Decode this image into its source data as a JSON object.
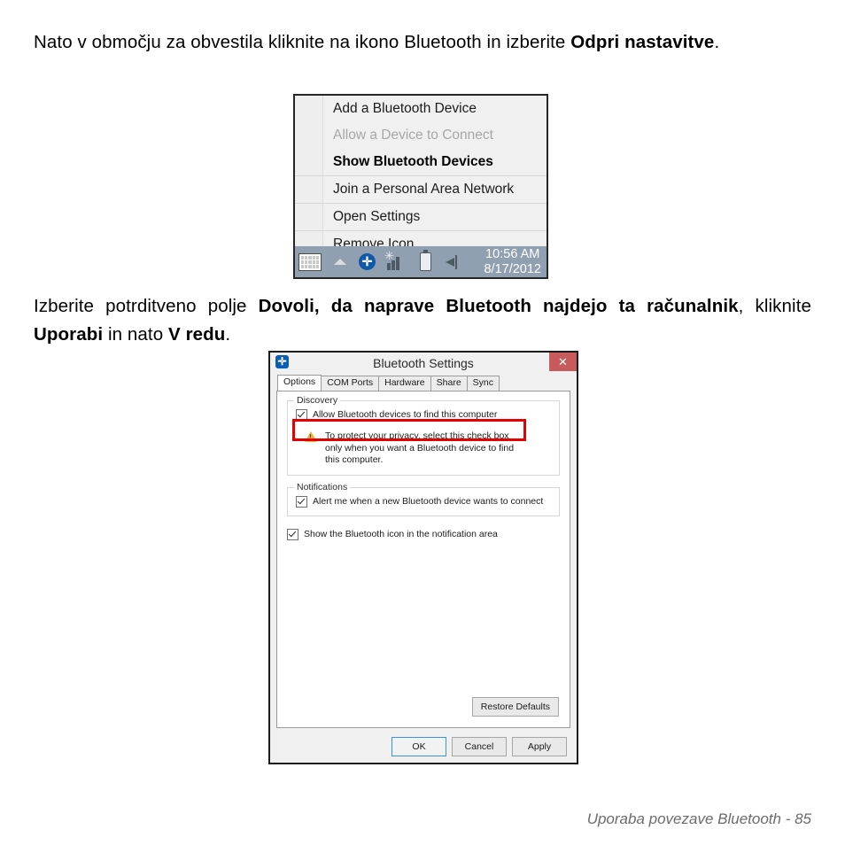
{
  "page": {
    "paragraph_1": {
      "before_bold": "Nato v območju za obvestila kliknite na ikono Bluetooth in izberite ",
      "bold": "Odpri nastavitve",
      "after_bold": "."
    },
    "paragraph_2": {
      "part_1": "Izberite potrditveno polje ",
      "bold_1": "Dovoli, da naprave Bluetooth najdejo ta računalnik",
      "part_2": ", kliknite ",
      "bold_2": "Uporabi",
      "part_3": " in nato ",
      "bold_3": "V redu",
      "part_4": "."
    },
    "footer": "Uporaba povezave Bluetooth -  85"
  },
  "tray_menu": {
    "groups": [
      {
        "items": [
          {
            "label": "Add a Bluetooth Device",
            "state": "normal"
          },
          {
            "label": "Allow a Device to Connect",
            "state": "disabled"
          },
          {
            "label": "Show Bluetooth Devices",
            "state": "bold"
          }
        ]
      },
      {
        "items": [
          {
            "label": "Join a Personal Area Network",
            "state": "normal"
          }
        ]
      },
      {
        "items": [
          {
            "label": "Open Settings",
            "state": "normal"
          }
        ]
      },
      {
        "items": [
          {
            "label": "Remove Icon",
            "state": "normal"
          }
        ]
      }
    ]
  },
  "taskbar": {
    "background_color": "#90a0b0",
    "icons": [
      "keyboard-icon",
      "show-hidden-icons-chevron",
      "bluetooth-icon",
      "network-signal-icon",
      "battery-icon",
      "volume-speaker-icon"
    ],
    "clock": {
      "time": "10:56 AM",
      "date": "8/17/2012"
    },
    "bluetooth_glyph": "✛"
  },
  "bluetooth_dialog": {
    "title": "Bluetooth Settings",
    "icon_glyph": "✛",
    "close_label": "✕",
    "close_color": "#c75b5b",
    "tabs": [
      {
        "label": "Options",
        "active": true
      },
      {
        "label": "COM Ports",
        "active": false
      },
      {
        "label": "Hardware",
        "active": false
      },
      {
        "label": "Share",
        "active": false
      },
      {
        "label": "Sync",
        "active": false
      }
    ],
    "discovery": {
      "group_label": "Discovery",
      "checkbox_label": "Allow Bluetooth devices to find this computer",
      "checked": true,
      "warning_text": "To protect your privacy, select this check box only when you want a Bluetooth device to find this computer.",
      "highlight_color": "#e50000"
    },
    "notifications": {
      "group_label": "Notifications",
      "checkbox_label": "Alert me when a new Bluetooth device wants to connect",
      "checked": true
    },
    "show_icon": {
      "checkbox_label": "Show the Bluetooth icon in the notification area",
      "checked": true
    },
    "restore_defaults_label": "Restore Defaults",
    "buttons": [
      {
        "label": "OK",
        "primary": true
      },
      {
        "label": "Cancel",
        "primary": false
      },
      {
        "label": "Apply",
        "primary": false
      }
    ]
  }
}
